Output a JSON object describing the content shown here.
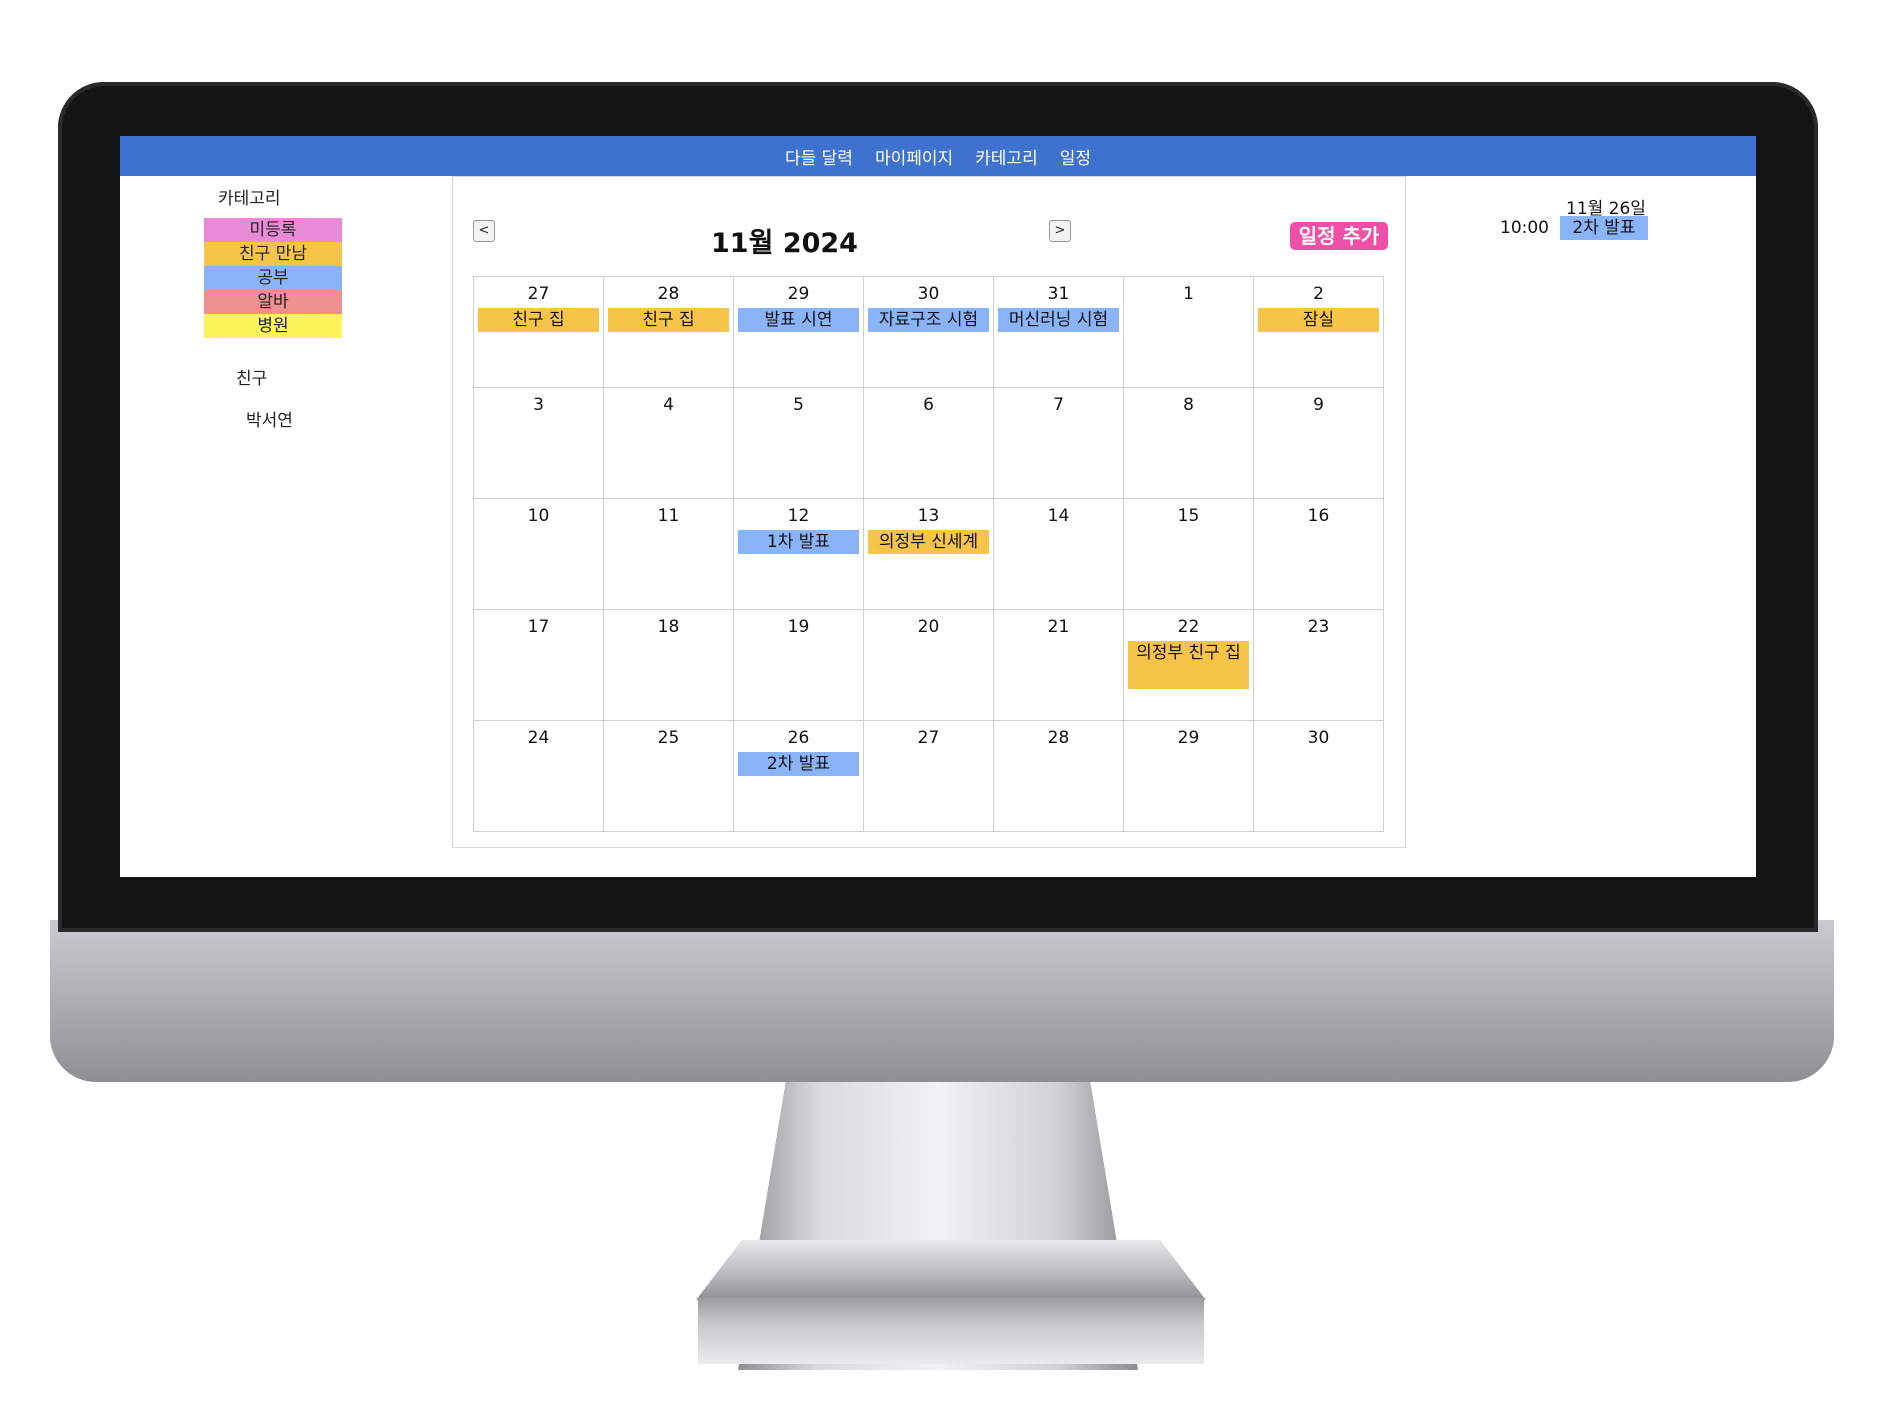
{
  "nav": [
    "다들 달력",
    "마이페이지",
    "카테고리",
    "일정"
  ],
  "sidebar": {
    "category_title": "카테고리",
    "categories": [
      {
        "label": "미등록",
        "color": "#e98ad6"
      },
      {
        "label": "친구 만남",
        "color": "#f7c44a"
      },
      {
        "label": "공부",
        "color": "#8ab4f8"
      },
      {
        "label": "알바",
        "color": "#ef8f8f"
      },
      {
        "label": "병원",
        "color": "#fdf45c"
      }
    ],
    "friends_title": "친구",
    "friends": [
      "박서연"
    ]
  },
  "calendar": {
    "title": "11월 2024",
    "prev_label": "<",
    "next_label": ">",
    "add_label": "일정 추가",
    "weeks": [
      [
        {
          "d": "27",
          "events": [
            {
              "t": "친구 집",
              "c": "friend"
            }
          ]
        },
        {
          "d": "28",
          "events": [
            {
              "t": "친구 집",
              "c": "friend"
            }
          ]
        },
        {
          "d": "29",
          "events": [
            {
              "t": "발표 시연",
              "c": "study"
            }
          ]
        },
        {
          "d": "30",
          "events": [
            {
              "t": "자료구조 시험",
              "c": "study"
            }
          ]
        },
        {
          "d": "31",
          "events": [
            {
              "t": "머신러닝 시험",
              "c": "study"
            }
          ]
        },
        {
          "d": "1",
          "events": []
        },
        {
          "d": "2",
          "events": [
            {
              "t": "잠실",
              "c": "friend"
            }
          ]
        }
      ],
      [
        {
          "d": "3",
          "events": []
        },
        {
          "d": "4",
          "events": []
        },
        {
          "d": "5",
          "events": []
        },
        {
          "d": "6",
          "events": []
        },
        {
          "d": "7",
          "events": []
        },
        {
          "d": "8",
          "events": []
        },
        {
          "d": "9",
          "events": []
        }
      ],
      [
        {
          "d": "10",
          "events": []
        },
        {
          "d": "11",
          "events": []
        },
        {
          "d": "12",
          "events": [
            {
              "t": "1차 발표",
              "c": "study"
            }
          ]
        },
        {
          "d": "13",
          "events": [
            {
              "t": "의정부 신세계",
              "c": "friend"
            }
          ]
        },
        {
          "d": "14",
          "events": []
        },
        {
          "d": "15",
          "events": []
        },
        {
          "d": "16",
          "events": []
        }
      ],
      [
        {
          "d": "17",
          "events": []
        },
        {
          "d": "18",
          "events": []
        },
        {
          "d": "19",
          "events": []
        },
        {
          "d": "20",
          "events": []
        },
        {
          "d": "21",
          "events": []
        },
        {
          "d": "22",
          "events": [
            {
              "t": "의정부 친구 집",
              "c": "friend",
              "tall": true
            }
          ]
        },
        {
          "d": "23",
          "events": []
        }
      ],
      [
        {
          "d": "24",
          "events": []
        },
        {
          "d": "25",
          "events": []
        },
        {
          "d": "26",
          "events": [
            {
              "t": "2차 발표",
              "c": "study"
            }
          ]
        },
        {
          "d": "27",
          "events": []
        },
        {
          "d": "28",
          "events": []
        },
        {
          "d": "29",
          "events": []
        },
        {
          "d": "30",
          "events": []
        }
      ]
    ]
  },
  "detail": {
    "date": "11월 26일",
    "time": "10:00",
    "event": "2차 발표"
  }
}
